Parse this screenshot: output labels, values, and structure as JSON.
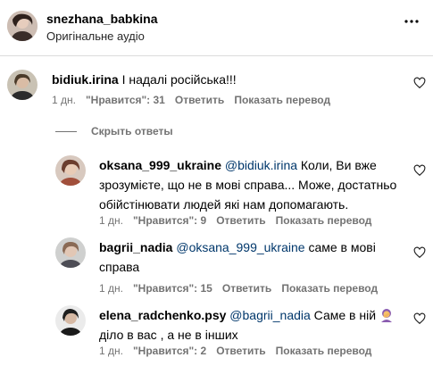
{
  "post": {
    "username": "snezhana_babkina",
    "audio": "Оригінальне аудіо"
  },
  "comments": [
    {
      "username": "bidiuk.irina",
      "text": "І надалі російська!!!",
      "time": "1 дн.",
      "likes": "\"Нравится\": 31",
      "reply": "Ответить",
      "translate": "Показать перевод"
    }
  ],
  "hide_replies": "Скрыть ответы",
  "replies": [
    {
      "username": "oksana_999_ukraine",
      "mention": "@bidiuk.irina",
      "text": " Коли, Ви вже зрозумієте, що не в мові справа... Може, достатньо обійстінювати людей які нам допомагають.",
      "time": "1 дн.",
      "likes": "\"Нравится\": 9",
      "reply": "Ответить",
      "translate": "Показать перевод"
    },
    {
      "username": "bagrii_nadia",
      "mention": "@oksana_999_ukraine",
      "text": " саме в мові справа",
      "time": "1 дн.",
      "likes": "\"Нравится\": 15",
      "reply": "Ответить",
      "translate": "Показать перевод"
    },
    {
      "username": "elena_radchenko.psy",
      "mention": "@bagrii_nadia",
      "text_a": " Саме в ній",
      "text_b": " діло в вас , а не в інших",
      "time": "1 дн.",
      "likes": "\"Нравится\": 2",
      "reply": "Ответить",
      "translate": "Показать перевод"
    }
  ],
  "icons": {
    "more": "more-horizontal-icon",
    "like": "heart-outline-icon",
    "emoji": "facepalm-emoji"
  }
}
